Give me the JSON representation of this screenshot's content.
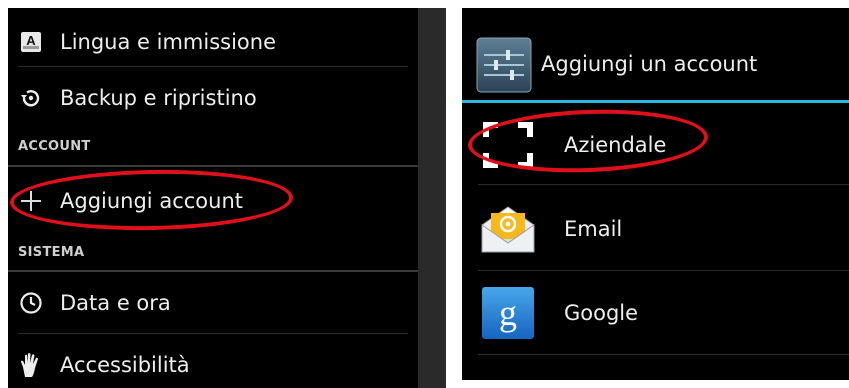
{
  "left": {
    "items": [
      {
        "label": "Lingua e immissione",
        "icon": "language-icon"
      },
      {
        "label": "Backup e ripristino",
        "icon": "backup-icon"
      },
      {
        "label": "Aggiungi account",
        "icon": "plus-icon"
      },
      {
        "label": "Data e ora",
        "icon": "clock-icon"
      },
      {
        "label": "Accessibilità",
        "icon": "hand-icon"
      }
    ],
    "section_account": "ACCOUNT",
    "section_sistema": "SISTEMA"
  },
  "right": {
    "title": "Aggiungi un account",
    "title_icon": "settings-sliders-icon",
    "items": [
      {
        "label": "Aziendale",
        "icon": "corporate-icon"
      },
      {
        "label": "Email",
        "icon": "email-icon"
      },
      {
        "label": "Google",
        "icon": "google-icon"
      }
    ]
  },
  "colors": {
    "background": "#000000",
    "highlight_ellipse": "#e0101a",
    "header_accent": "#33b5e5"
  }
}
